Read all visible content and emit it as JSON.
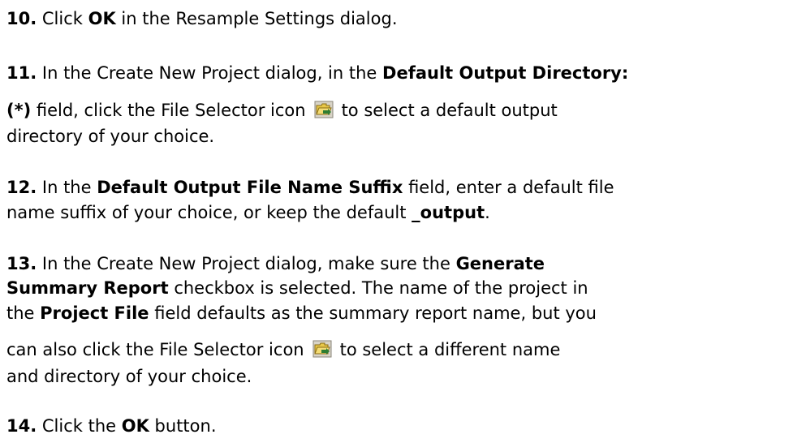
{
  "steps": [
    {
      "number": "10.",
      "segments": [
        "Click ",
        "OK",
        " in the Resample Settings dialog."
      ]
    },
    {
      "number": "11.",
      "line1": [
        "In the Create New Project dialog, in the ",
        "Default Output Directory:"
      ],
      "line2": [
        "(*)",
        " field, click the File Selector icon",
        "to select a default output"
      ],
      "line3": "directory of your choice."
    },
    {
      "number": "12.",
      "line1": [
        "In the ",
        "Default Output File Name Suffix",
        " field, enter a default file"
      ],
      "line2": [
        "name suffix of your choice, or keep the default ",
        "_output",
        "."
      ]
    },
    {
      "number": "13.",
      "line1": [
        "In the Create New Project dialog, make sure the ",
        "Generate"
      ],
      "line2": [
        "Summary Report",
        " checkbox is selected. The name of the project in"
      ],
      "line3": [
        "the ",
        "Project File",
        " field defaults as the summary report name, but you"
      ],
      "line4": [
        "can also click the File Selector icon",
        "to select a different name"
      ],
      "line5": "and directory of your choice."
    },
    {
      "number": "14.",
      "segments": [
        "Click the ",
        "OK",
        " button."
      ]
    }
  ],
  "icons": {
    "file_selector": "folder-open-icon"
  },
  "colors": {
    "text": "#000000",
    "background": "#ffffff",
    "folder_fill": "#e8c84a",
    "arrow": "#2e7d32"
  }
}
